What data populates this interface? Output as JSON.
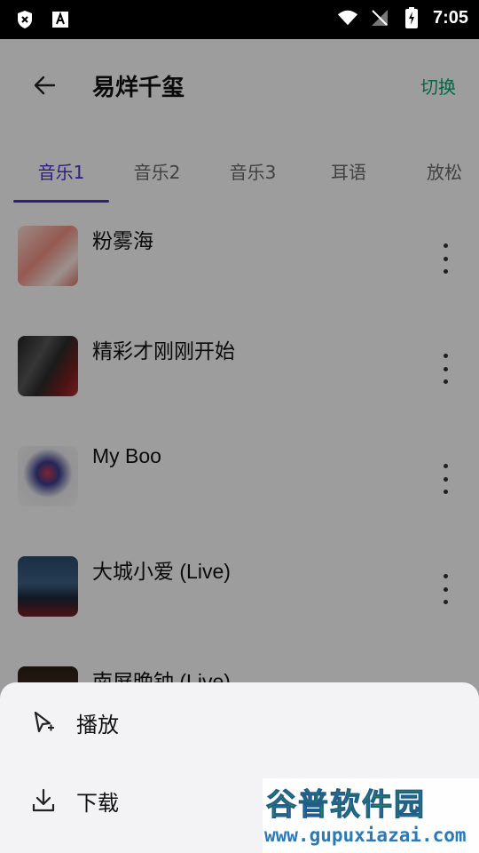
{
  "status_bar": {
    "time": "7:05"
  },
  "app_bar": {
    "title": "易烊千玺",
    "action_label": "切换"
  },
  "tabs": [
    {
      "label": "音乐1",
      "active": true
    },
    {
      "label": "音乐2",
      "active": false
    },
    {
      "label": "音乐3",
      "active": false
    },
    {
      "label": "耳语",
      "active": false
    },
    {
      "label": "放松",
      "active": false
    }
  ],
  "songs": [
    {
      "title": "粉雾海"
    },
    {
      "title": "精彩才刚刚开始"
    },
    {
      "title": "My Boo"
    },
    {
      "title": "大城小爱 (Live)"
    },
    {
      "title": "南屏晚钟 (Live)"
    }
  ],
  "bottom_sheet": {
    "play_label": "播放",
    "download_label": "下载"
  },
  "watermark": {
    "text": "谷普软件园",
    "url": "www.gupuxiazai.com"
  },
  "colors": {
    "accent": "#4b2fc4",
    "action": "#0aa06e"
  }
}
